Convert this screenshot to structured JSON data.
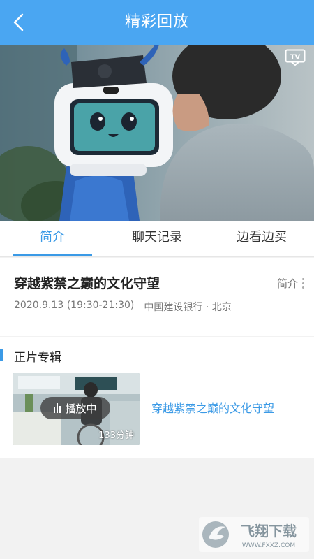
{
  "header": {
    "title": "精彩回放"
  },
  "tabs": [
    {
      "label": "简介",
      "active": true
    },
    {
      "label": "聊天记录",
      "active": false
    },
    {
      "label": "边看边买",
      "active": false
    }
  ],
  "info": {
    "title": "穿越紫禁之巅的文化守望",
    "intro_label": "简介",
    "time": "2020.9.13 (19:30-21:30)",
    "place": "中国建设银行 · 北京"
  },
  "album": {
    "heading": "正片专辑",
    "items": [
      {
        "title": "穿越紫禁之巅的文化守望",
        "status": "播放中",
        "duration": "133分钟"
      }
    ]
  },
  "video": {
    "tv_label": "TV"
  },
  "watermark": {
    "brand": "飞翔下载",
    "url": "WWW.FXXZ.COM"
  },
  "colors": {
    "header": "#4aa6f2",
    "accent": "#3b9ae6"
  }
}
